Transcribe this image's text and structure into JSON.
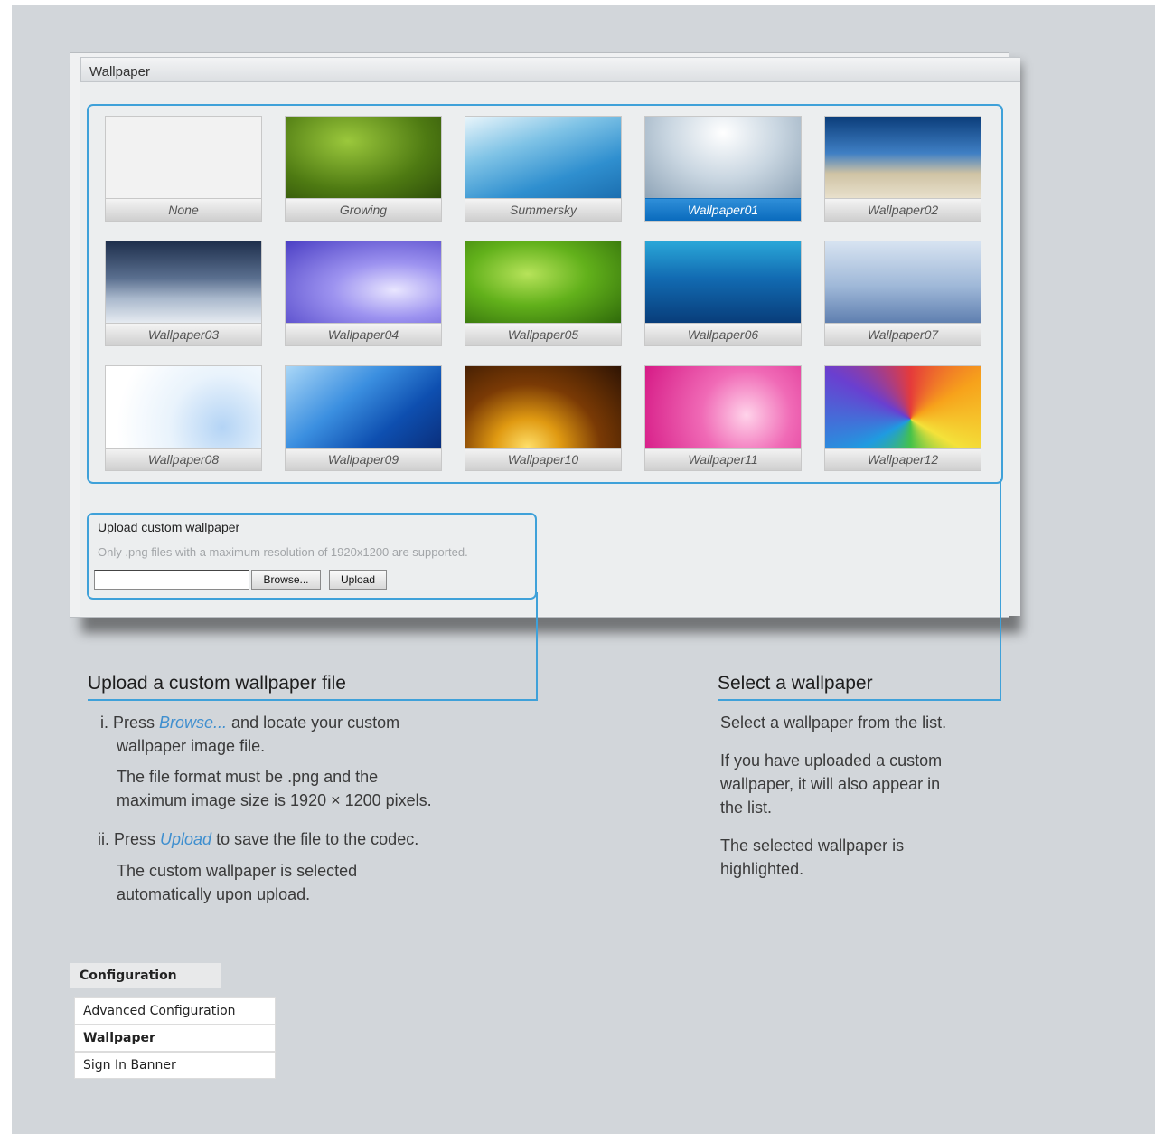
{
  "window": {
    "title": "Wallpaper"
  },
  "wallpapers": [
    {
      "label": "None",
      "selected": false
    },
    {
      "label": "Growing",
      "selected": false
    },
    {
      "label": "Summersky",
      "selected": false
    },
    {
      "label": "Wallpaper01",
      "selected": true
    },
    {
      "label": "Wallpaper02",
      "selected": false
    },
    {
      "label": "Wallpaper03",
      "selected": false
    },
    {
      "label": "Wallpaper04",
      "selected": false
    },
    {
      "label": "Wallpaper05",
      "selected": false
    },
    {
      "label": "Wallpaper06",
      "selected": false
    },
    {
      "label": "Wallpaper07",
      "selected": false
    },
    {
      "label": "Wallpaper08",
      "selected": false
    },
    {
      "label": "Wallpaper09",
      "selected": false
    },
    {
      "label": "Wallpaper10",
      "selected": false
    },
    {
      "label": "Wallpaper11",
      "selected": false
    },
    {
      "label": "Wallpaper12",
      "selected": false
    }
  ],
  "upload": {
    "title": "Upload custom wallpaper",
    "note": "Only .png files with a maximum resolution of 1920x1200 are supported.",
    "file_value": "",
    "browse_label": "Browse...",
    "upload_label": "Upload"
  },
  "help_upload": {
    "heading": "Upload a custom wallpaper file",
    "step1_prefix": "i. Press ",
    "step1_link": "Browse...",
    "step1_suffix": " and locate your custom",
    "step1_line2": "wallpaper image file.",
    "step1_note_line1": "The file format must be .png and the",
    "step1_note_line2": "maximum image size is 1920 × 1200 pixels.",
    "step2_prefix": "ii. Press ",
    "step2_link": "Upload",
    "step2_suffix": " to save the file to the codec.",
    "step2_note_line1": "The custom wallpaper is selected",
    "step2_note_line2": "automatically upon upload."
  },
  "help_select": {
    "heading": "Select a wallpaper",
    "p1": "Select a wallpaper from the list.",
    "p2_line1": "If you have uploaded a custom",
    "p2_line2": "wallpaper, it will also appear in",
    "p2_line3": "the list.",
    "p3_line1": "The selected wallpaper is",
    "p3_line2": "highlighted."
  },
  "config_menu": {
    "heading": "Configuration",
    "items": [
      "Advanced Configuration",
      "Wallpaper",
      "Sign In Banner"
    ],
    "active": "Wallpaper"
  },
  "colors": {
    "accent": "#3fa1d9",
    "selected": "#0a6bbd"
  }
}
